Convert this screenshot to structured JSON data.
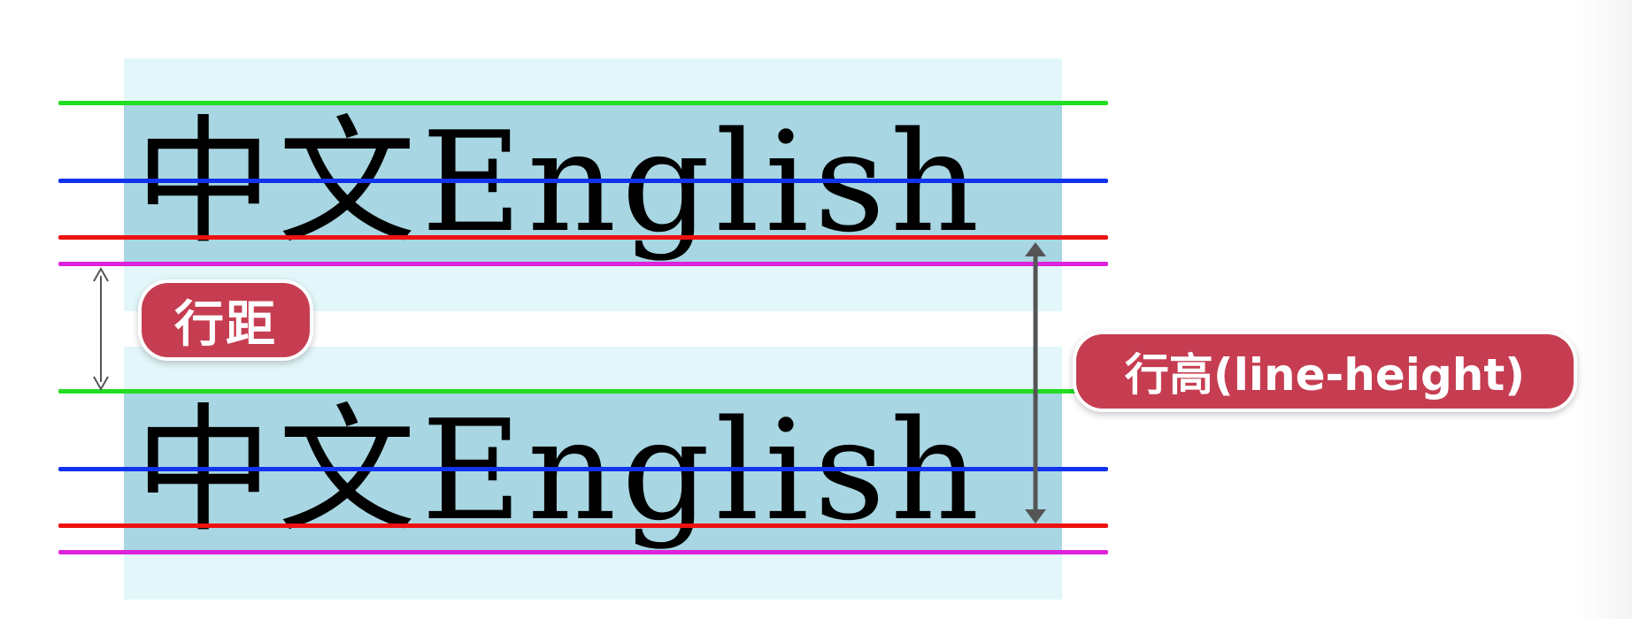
{
  "sample_line_1": "中文English",
  "sample_line_2": "中文English",
  "label_line_gap": "行距",
  "label_line_height": "行高(line-height)",
  "colors": {
    "line_box": "#e3f7fb",
    "content_area": "#a8d6e2",
    "top_line": "#22dd22",
    "middle_line": "#1133ee",
    "baseline": "#ee1111",
    "bottom_line": "#dd22dd",
    "label_background": "#c63d51",
    "arrow": "#555555"
  }
}
